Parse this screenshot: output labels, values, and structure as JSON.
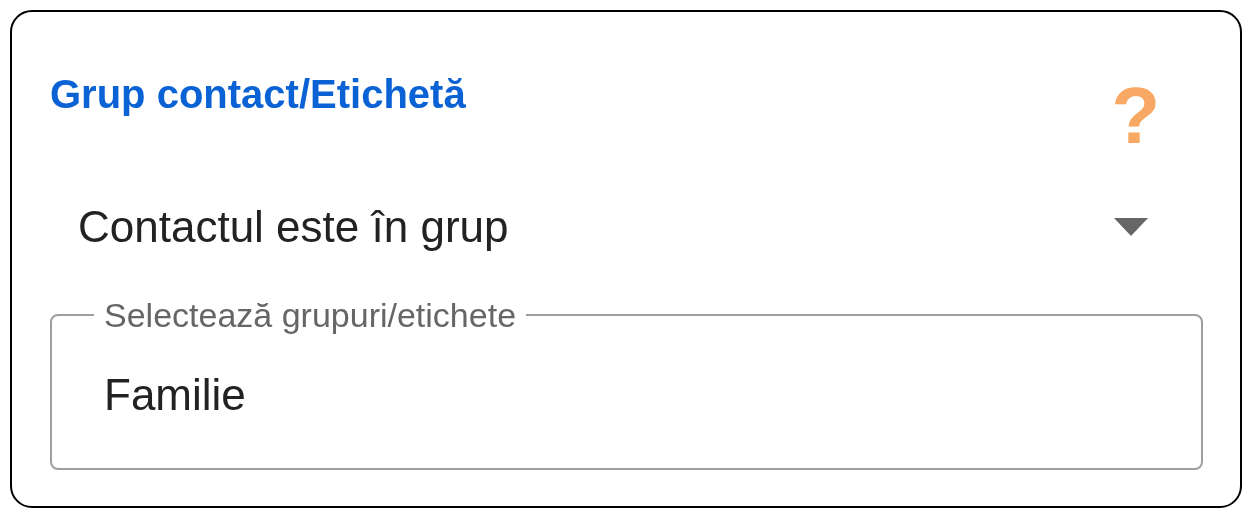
{
  "card": {
    "title": "Grup contact/Etichetă",
    "help": "?"
  },
  "dropdown": {
    "value": "Contactul este în grup"
  },
  "field": {
    "label": "Selectează grupuri/etichete",
    "value": "Familie"
  }
}
